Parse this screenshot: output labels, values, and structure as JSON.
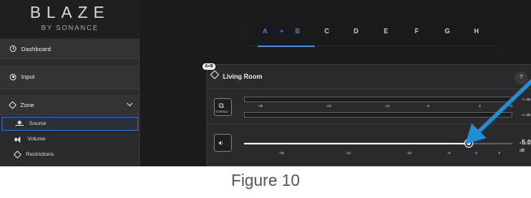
{
  "logo": {
    "main": "BLAZE",
    "sub": "BY SONANCE"
  },
  "sidebar": {
    "dashboard": {
      "label": "Dashboard",
      "icon": "clock-icon"
    },
    "input": {
      "label": "Input",
      "icon": "input-icon"
    },
    "zone": {
      "label": "Zone",
      "icon": "zone-icon"
    },
    "zone_items": [
      {
        "label": "Source",
        "icon": "source-icon",
        "selected": true
      },
      {
        "label": "Volume",
        "icon": "speaker-icon"
      },
      {
        "label": "Restrictions",
        "icon": "restrictions-icon"
      }
    ]
  },
  "tabs": {
    "items": [
      "A",
      "+",
      "B",
      "C",
      "D",
      "E",
      "F",
      "G",
      "H"
    ],
    "active": "A + B"
  },
  "zone_panel": {
    "badge": "A+B",
    "title": "Living Room",
    "help_label": "?",
    "stereo_label": "STEREO",
    "meter_scale": [
      "-48",
      "-24",
      "-12",
      "-6",
      "0",
      "+6"
    ],
    "meter_right": [
      "-∞ dB",
      "-∞ dB"
    ],
    "volume_scale": [
      "-48",
      "-24",
      "-12",
      "-6",
      "-3",
      "0"
    ],
    "volume_value": "-5.0",
    "volume_unit": "dB",
    "volume_fraction": 0.84
  },
  "colors": {
    "accent": "#3c86e0",
    "arrow": "#1e8fd6"
  },
  "caption": "Figure 10"
}
